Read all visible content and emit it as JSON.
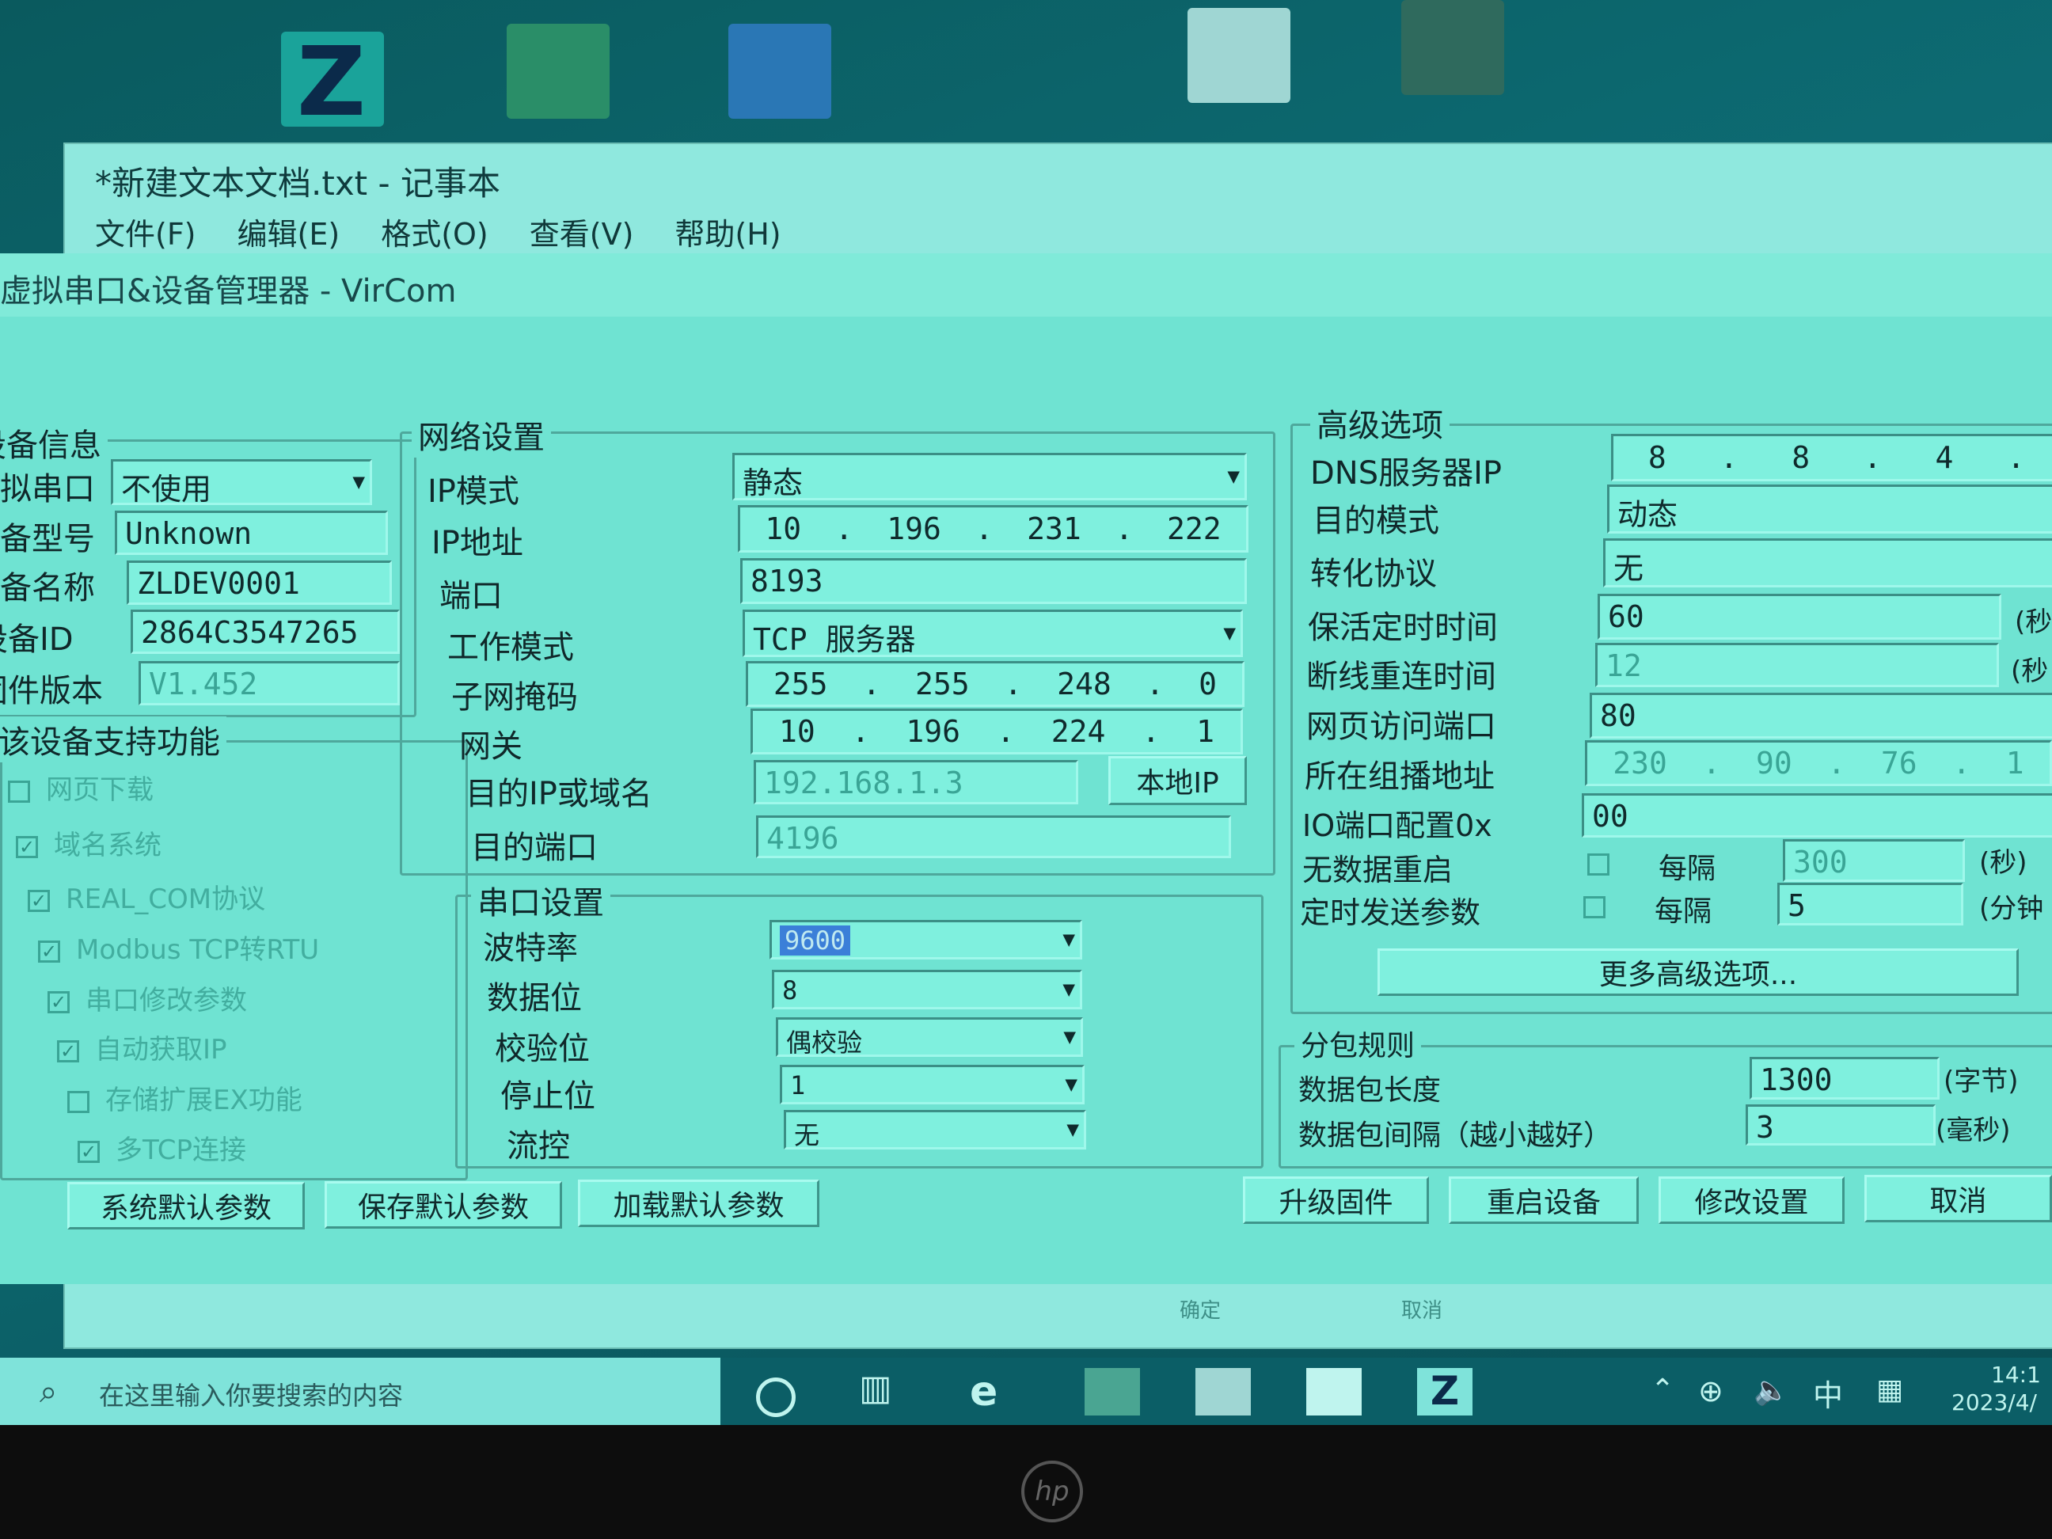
{
  "notepad": {
    "title": "*新建文本文档.txt - 记事本",
    "menu": [
      "文件(F)",
      "编辑(E)",
      "格式(O)",
      "查看(V)",
      "帮助(H)"
    ]
  },
  "window": {
    "title": "虚拟串口&设备管理器 - VirCom"
  },
  "device_info": {
    "group_title": "设备信息",
    "virtual_port_label": "虚拟串口",
    "virtual_port_value": "不使用",
    "model_label": "设备型号",
    "model_value": "Unknown",
    "name_label": "设备名称",
    "name_value": "ZLDEV0001",
    "id_label": "设备ID",
    "id_value": "2864C3547265",
    "firmware_label": "固件版本",
    "firmware_value": "V1.452"
  },
  "features": {
    "group_title": "该设备支持功能",
    "items": [
      {
        "label": "网页下载",
        "checked": false
      },
      {
        "label": "域名系统",
        "checked": true
      },
      {
        "label": "REAL_COM协议",
        "checked": true
      },
      {
        "label": "Modbus TCP转RTU",
        "checked": true
      },
      {
        "label": "串口修改参数",
        "checked": true
      },
      {
        "label": "自动获取IP",
        "checked": true
      },
      {
        "label": "存储扩展EX功能",
        "checked": false
      },
      {
        "label": "多TCP连接",
        "checked": true
      }
    ]
  },
  "network": {
    "group_title": "网络设置",
    "ip_mode_label": "IP模式",
    "ip_mode_value": "静态",
    "ip_label": "IP地址",
    "ip": [
      "10",
      "196",
      "231",
      "222"
    ],
    "port_label": "端口",
    "port_value": "8193",
    "work_mode_label": "工作模式",
    "work_mode_value": "TCP  服务器",
    "mask_label": "子网掩码",
    "mask": [
      "255",
      "255",
      "248",
      "0"
    ],
    "gateway_label": "网关",
    "gateway": [
      "10",
      "196",
      "224",
      "1"
    ],
    "dest_ip_label": "目的IP或域名",
    "dest_ip_value": "192.168.1.3",
    "local_ip_button": "本地IP",
    "dest_port_label": "目的端口",
    "dest_port_value": "4196"
  },
  "serial": {
    "group_title": "串口设置",
    "baud_label": "波特率",
    "baud_value": "9600",
    "data_bits_label": "数据位",
    "data_bits_value": "8",
    "parity_label": "校验位",
    "parity_value": "偶校验",
    "stop_bits_label": "停止位",
    "stop_bits_value": "1",
    "flow_label": "流控",
    "flow_value": "无"
  },
  "advanced": {
    "group_title": "高级选项",
    "dns_label": "DNS服务器IP",
    "dns": [
      "8",
      "8",
      "4"
    ],
    "dest_mode_label": "目的模式",
    "dest_mode_value": "动态",
    "protocol_label": "转化协议",
    "protocol_value": "无",
    "keepalive_label": "保活定时时间",
    "keepalive_value": "60",
    "keepalive_unit": "(秒",
    "reconnect_label": "断线重连时间",
    "reconnect_value": "12",
    "reconnect_unit": "(秒",
    "web_port_label": "网页访问端口",
    "web_port_value": "80",
    "multicast_label": "所在组播地址",
    "multicast": [
      "230",
      "90",
      "76",
      "1"
    ],
    "io_label": "IO端口配置0x",
    "io_value": "00",
    "nodata_label": "无数据重启",
    "nodata_every": "每隔",
    "nodata_value": "300",
    "nodata_unit": "(秒)",
    "timed_label": "定时发送参数",
    "timed_every": "每隔",
    "timed_value": "5",
    "timed_unit": "(分钟",
    "more_button": "更多高级选项..."
  },
  "packet": {
    "group_title": "分包规则",
    "length_label": "数据包长度",
    "length_value": "1300",
    "length_unit": "(字节)",
    "interval_label": "数据包间隔（越小越好）",
    "interval_value": "3",
    "interval_unit": "(毫秒)"
  },
  "buttons": {
    "sys_default": "系统默认参数",
    "save_default": "保存默认参数",
    "load_default": "加载默认参数",
    "upgrade": "升级固件",
    "restart": "重启设备",
    "modify": "修改设置",
    "cancel": "取消"
  },
  "background_dialog": {
    "ok": "确定",
    "cancel": "取消"
  },
  "taskbar": {
    "search_placeholder": "在这里输入你要搜索的内容",
    "ime": "中",
    "time": "14:1",
    "date": "2023/4/"
  },
  "colors": {
    "screen_tint": "#6fe3d2",
    "taskbar": "#0b5e66"
  }
}
